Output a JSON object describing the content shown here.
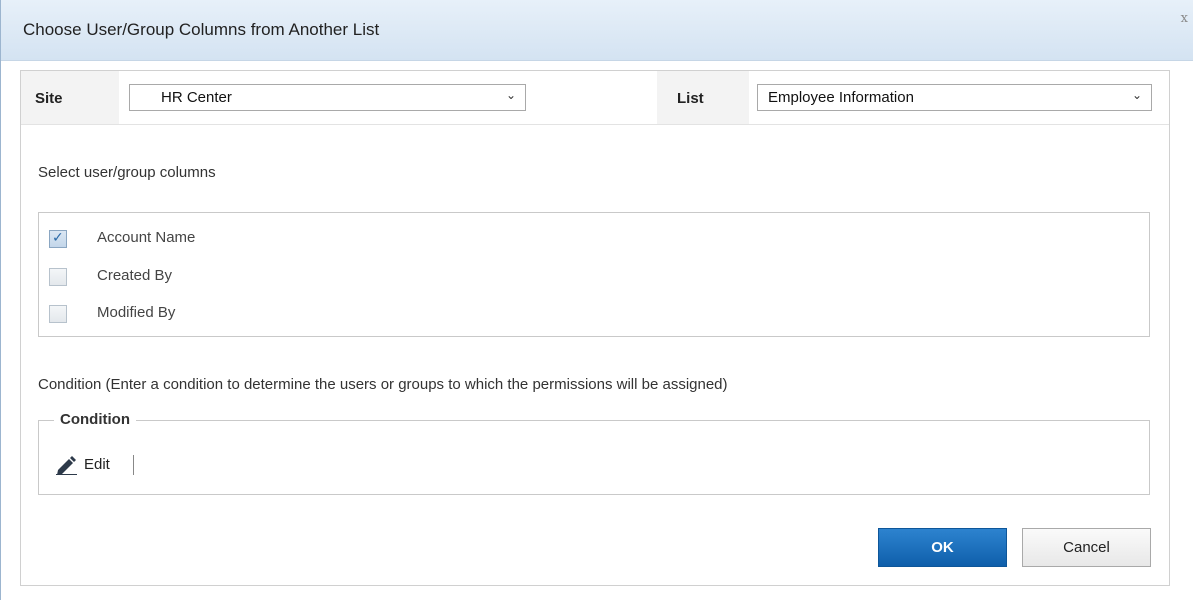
{
  "dialog": {
    "title": "Choose User/Group Columns from Another List",
    "close_glyph": "x"
  },
  "site": {
    "label": "Site",
    "value": "HR Center",
    "chevron": "⌄"
  },
  "list": {
    "label": "List",
    "value": "Employee Information",
    "chevron": "⌄"
  },
  "columns": {
    "heading": "Select user/group columns",
    "items": [
      {
        "label": "Account Name",
        "checked": true
      },
      {
        "label": "Created By",
        "checked": false
      },
      {
        "label": "Modified By",
        "checked": false
      }
    ]
  },
  "condition": {
    "description": "Condition (Enter a condition to determine the users or groups to which the permissions will be assigned)",
    "legend": "Condition",
    "edit_label": "Edit"
  },
  "buttons": {
    "ok": "OK",
    "cancel": "Cancel"
  },
  "colors": {
    "accent": "#1a6fbe",
    "titlebar": "#dce8f5"
  }
}
